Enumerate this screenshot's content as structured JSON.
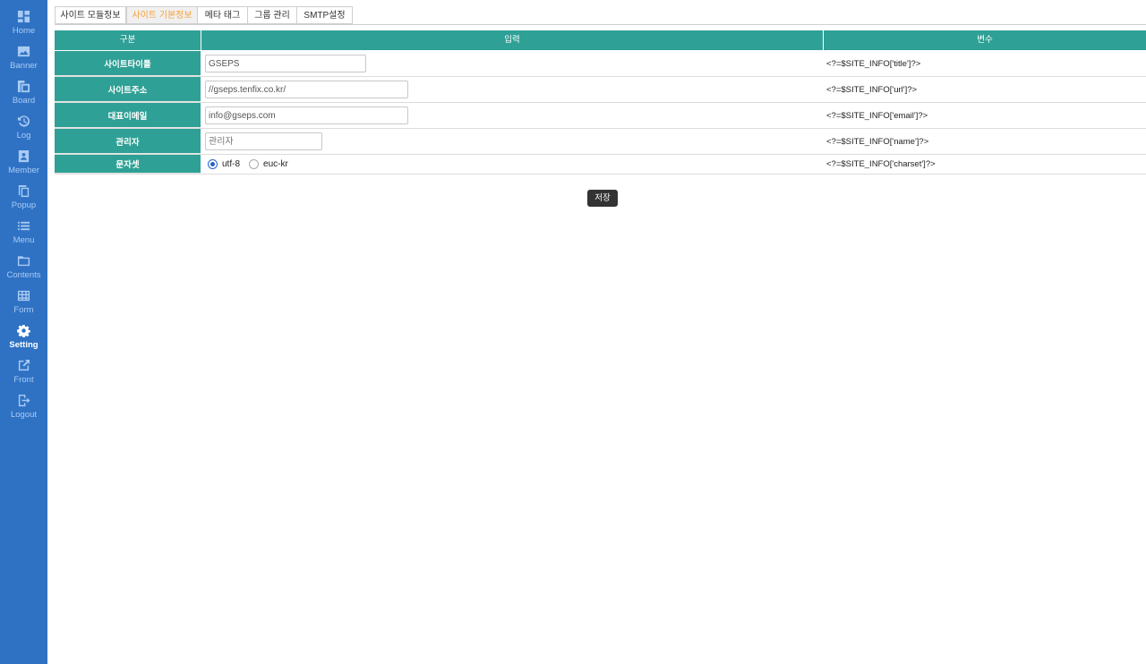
{
  "sidebar": {
    "items": [
      {
        "label": "Home",
        "icon": "dashboard-icon"
      },
      {
        "label": "Banner",
        "icon": "image-icon"
      },
      {
        "label": "Board",
        "icon": "board-icon"
      },
      {
        "label": "Log",
        "icon": "history-icon"
      },
      {
        "label": "Member",
        "icon": "member-badge-icon"
      },
      {
        "label": "Popup",
        "icon": "copy-icon"
      },
      {
        "label": "Menu",
        "icon": "list-icon"
      },
      {
        "label": "Contents",
        "icon": "folder-icon"
      },
      {
        "label": "Form",
        "icon": "table-icon"
      },
      {
        "label": "Setting",
        "icon": "gear-icon",
        "active": true
      },
      {
        "label": "Front",
        "icon": "external-link-icon"
      },
      {
        "label": "Logout",
        "icon": "logout-icon"
      }
    ]
  },
  "tabs": [
    "사이트 모듈정보",
    "사이트 기본정보",
    "메타 태그",
    "그룹 관리",
    "SMTP설정"
  ],
  "active_tab": "사이트 기본정보",
  "table": {
    "headers": {
      "label": "구분",
      "input": "입력",
      "variable": "변수"
    },
    "rows": [
      {
        "label": "사이트타이틀",
        "value": "GSEPS",
        "placeholder": "",
        "variable": "<?=$SITE_INFO['title']?>"
      },
      {
        "label": "사이트주소",
        "value": "//gseps.tenfix.co.kr/",
        "placeholder": "",
        "variable": "<?=$SITE_INFO['url']?>"
      },
      {
        "label": "대표이메일",
        "value": "info@gseps.com",
        "placeholder": "",
        "variable": "<?=$SITE_INFO['email']?>"
      },
      {
        "label": "관리자",
        "value": "",
        "placeholder": "관리자",
        "variable": "<?=$SITE_INFO['name']?>"
      },
      {
        "label": "문자셋",
        "radio": [
          {
            "label": "utf-8",
            "checked": true
          },
          {
            "label": "euc-kr",
            "checked": false
          }
        ],
        "variable": "<?=$SITE_INFO['charset']?>"
      }
    ]
  },
  "save_label": "저장",
  "colors": {
    "sidebar": "#2f72c4",
    "header": "#2fa095",
    "active_tab_text": "#f5a13c"
  }
}
